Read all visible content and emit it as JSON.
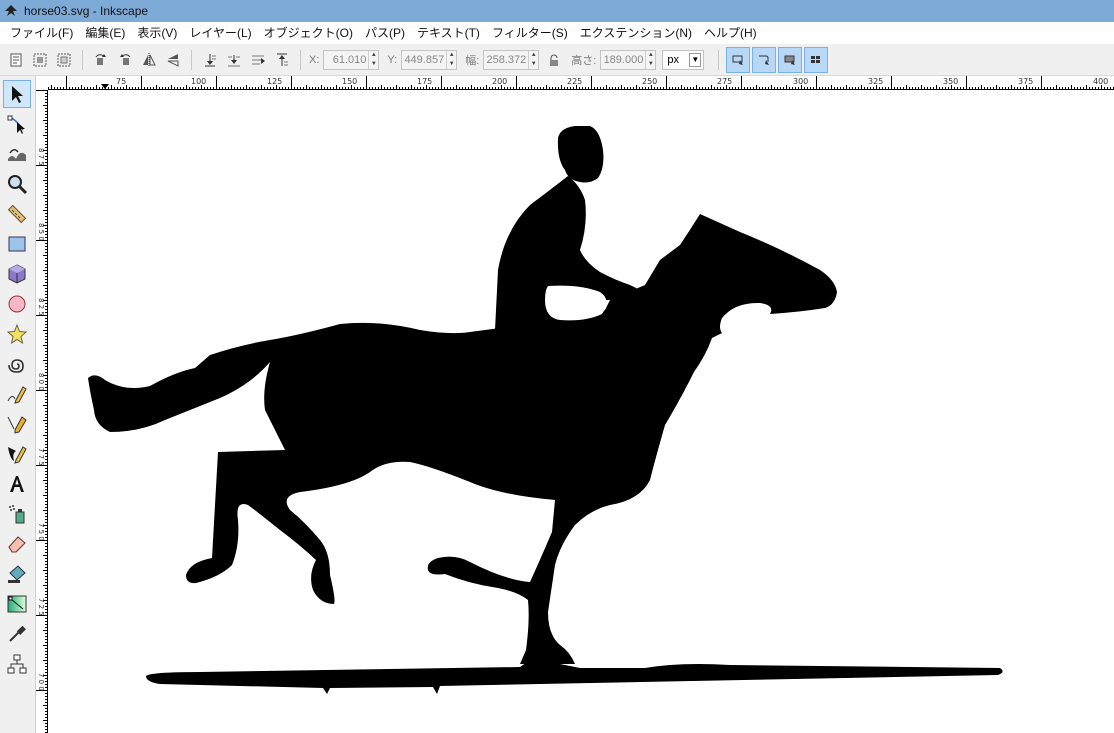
{
  "window": {
    "title": "horse03.svg - Inkscape",
    "app_icon": "inkscape-icon"
  },
  "menu": [
    "ファイル(F)",
    "編集(E)",
    "表示(V)",
    "レイヤー(L)",
    "オブジェクト(O)",
    "パス(P)",
    "テキスト(T)",
    "フィルター(S)",
    "エクステンション(N)",
    "ヘルプ(H)"
  ],
  "controls": {
    "x_label": "X:",
    "x_value": "61.010",
    "y_label": "Y:",
    "y_value": "449.857",
    "w_label": "幅:",
    "w_value": "258.372",
    "h_label": "高さ:",
    "h_value": "189.000",
    "unit": "px"
  },
  "ruler": {
    "ticks": [
      "75",
      "100",
      "125",
      "150",
      "175",
      "200",
      "225",
      "250",
      "275",
      "300",
      "325",
      "350",
      "375",
      "400"
    ],
    "vertical_labels": [
      "8 7 5",
      "8 5 0",
      "8 2 5",
      "8 0 0",
      "7 7 5",
      "7 5 0",
      "7 2 5",
      "7 0 0"
    ]
  },
  "tools": [
    "selector-tool-icon",
    "node-tool-icon",
    "tweak-tool-icon",
    "zoom-tool-icon",
    "measure-tool-icon",
    "rectangle-tool-icon",
    "3d-box-tool-icon",
    "ellipse-tool-icon",
    "star-tool-icon",
    "spiral-tool-icon",
    "pencil-tool-icon",
    "pen-tool-icon",
    "calligraphy-tool-icon",
    "text-tool-icon",
    "spray-tool-icon",
    "eraser-tool-icon",
    "paint-bucket-tool-icon",
    "gradient-tool-icon",
    "dropper-tool-icon",
    "connector-tool-icon"
  ],
  "colors": {
    "titlebar": "#7eaad8",
    "toggle_active": "#b8d8f8",
    "silhouette": "#000000"
  }
}
